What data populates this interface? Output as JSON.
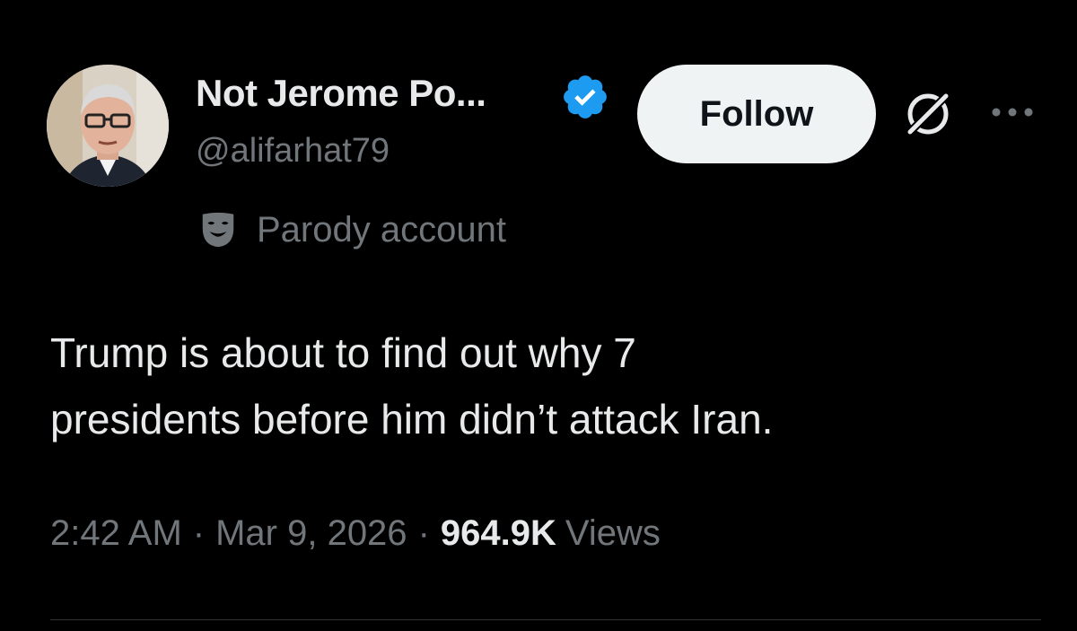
{
  "author": {
    "display_name": "Not Jerome Po...",
    "handle": "@alifarhat79",
    "parody_label": "Parody account",
    "verified_color": "#1d9bf0"
  },
  "actions": {
    "follow_label": "Follow",
    "grok_icon": "grok-icon",
    "more_icon": "more-options-icon"
  },
  "tweet": {
    "text_lines": [
      "Trump is about to find out why 7",
      "presidents before him didn’t attack Iran."
    ]
  },
  "meta": {
    "time": "2:42 AM",
    "separator": "·",
    "date": "Mar 9, 2026",
    "views_count": "964.9K",
    "views_label": "Views"
  },
  "theme": {
    "background": "#000000",
    "text": "#e7e9ea",
    "secondary_text": "#71767b",
    "button_bg": "#eff3f4"
  }
}
